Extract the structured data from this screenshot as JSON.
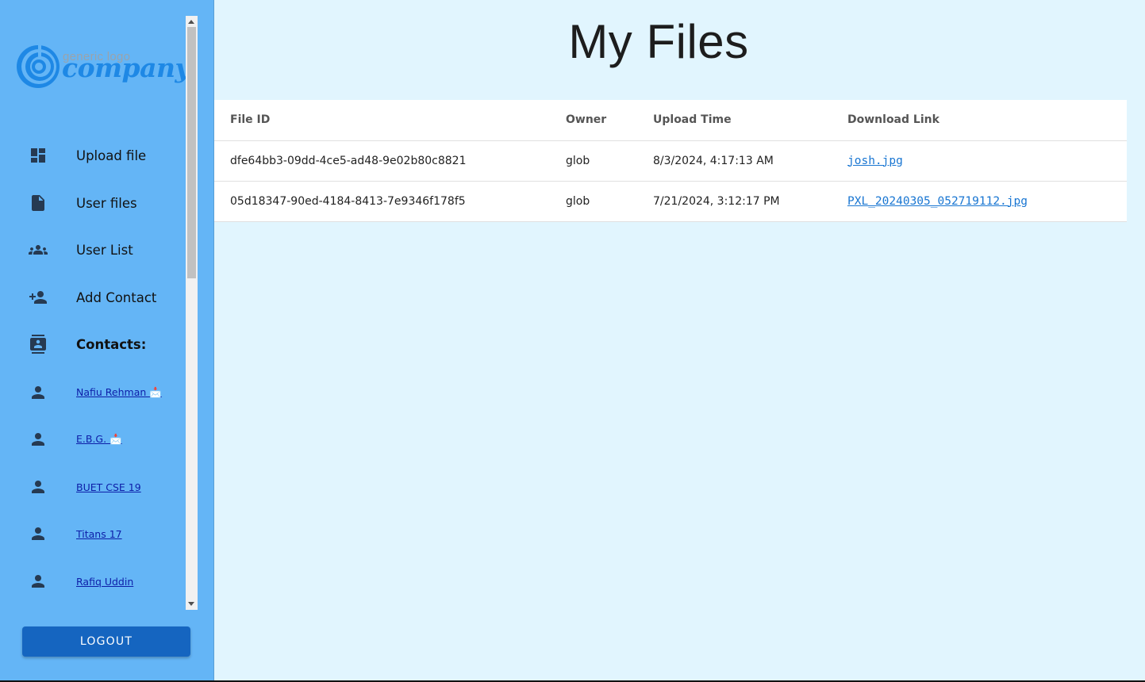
{
  "logo": {
    "small_text": "generic logo",
    "big_text": "company"
  },
  "sidebar": {
    "nav": [
      {
        "label": "Upload file",
        "icon": "dashboard-icon"
      },
      {
        "label": "User files",
        "icon": "file-icon"
      },
      {
        "label": "User List",
        "icon": "group-icon"
      },
      {
        "label": "Add Contact",
        "icon": "person-add-icon"
      },
      {
        "label": "Contacts:",
        "icon": "contacts-icon"
      }
    ],
    "contacts": [
      {
        "label": "Nafiu Rehman 📩",
        "icon": "person-icon"
      },
      {
        "label": "E.B.G. 📩",
        "icon": "person-icon"
      },
      {
        "label": "BUET CSE 19",
        "icon": "person-icon"
      },
      {
        "label": "Titans 17",
        "icon": "person-icon"
      },
      {
        "label": "Rafiq Uddin",
        "icon": "person-icon"
      }
    ],
    "logout_label": "LOGOUT"
  },
  "main": {
    "title": "My Files",
    "table": {
      "headers": [
        "File ID",
        "Owner",
        "Upload Time",
        "Download Link"
      ],
      "rows": [
        {
          "file_id": "dfe64bb3-09dd-4ce5-ad48-9e02b80c8821",
          "owner": "glob",
          "upload_time": "8/3/2024, 4:17:13 AM",
          "link": "josh.jpg"
        },
        {
          "file_id": "05d18347-90ed-4184-8413-7e9346f178f5",
          "owner": "glob",
          "upload_time": "7/21/2024, 3:12:17 PM",
          "link": "PXL_20240305_052719112.jpg"
        }
      ]
    }
  },
  "colors": {
    "sidebar_bg": "#64b5f6",
    "main_bg": "#e1f5fe",
    "logout_bg": "#1565c0",
    "link": "#1976d2",
    "logo_blue": "#1e88e5"
  }
}
